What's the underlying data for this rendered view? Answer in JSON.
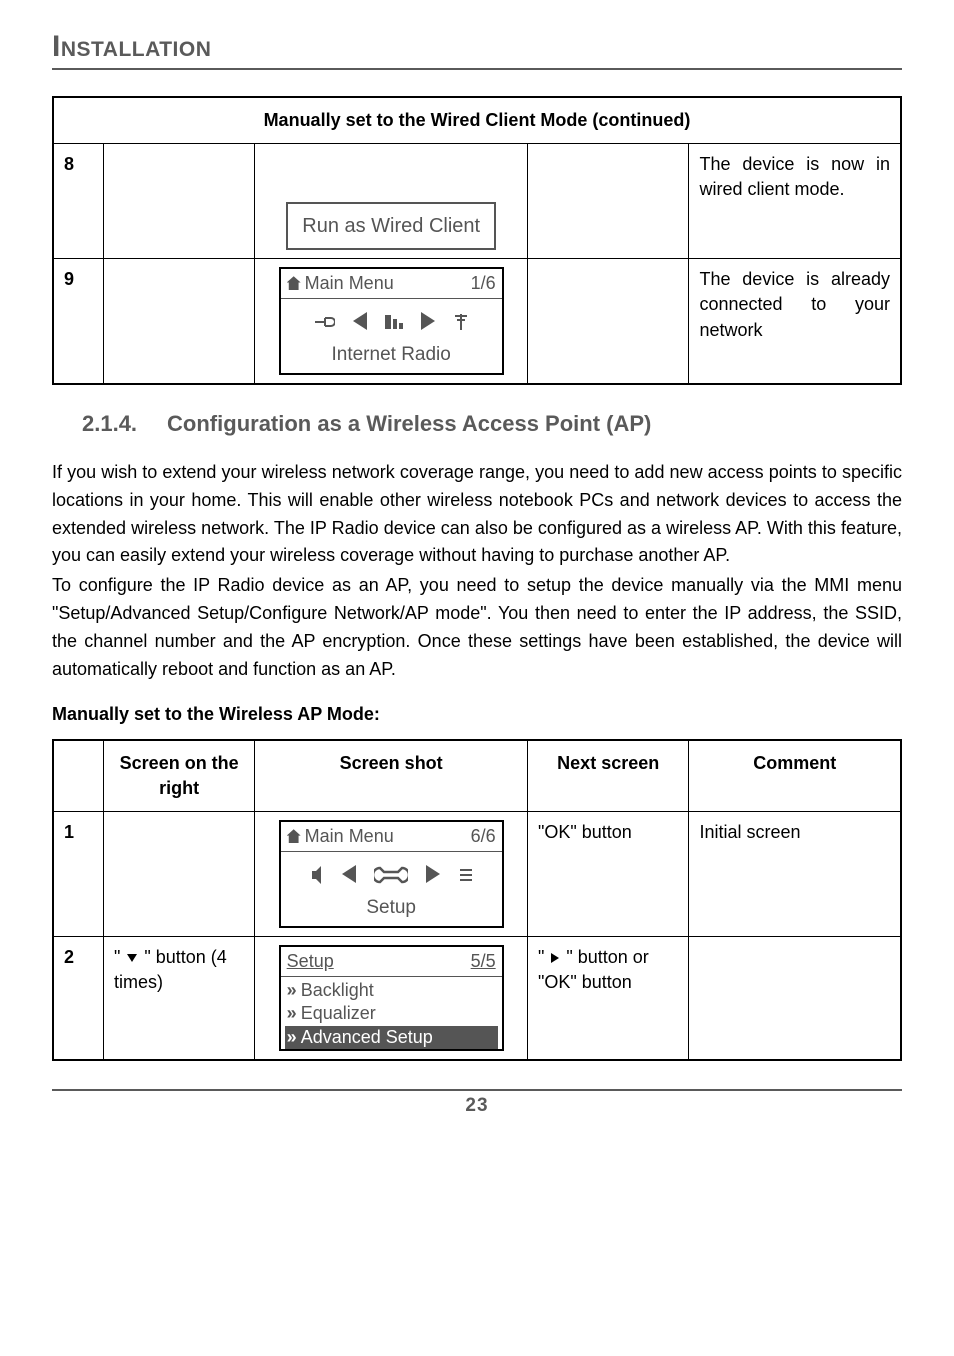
{
  "page_title": "Installation",
  "table1": {
    "header": "Manually set to the Wired Client Mode (continued)",
    "rows": [
      {
        "step": "8",
        "shot_caption": "Run as Wired Client",
        "comment": "The device is now in wired client mode."
      },
      {
        "step": "9",
        "menu_title": "Main Menu",
        "menu_page": "1/6",
        "shot_caption": "Internet Radio",
        "comment": "The device is already connected to your network"
      }
    ]
  },
  "section": {
    "number": "2.1.4.",
    "title": "Configuration as a Wireless Access Point (AP)"
  },
  "paragraphs": {
    "p1": "If you wish to extend your wireless network coverage range, you need to add new access points to specific locations in your home. This will enable other wireless notebook PCs and network devices to access the extended wireless network. The IP Radio device can also be configured as a wireless AP. With this feature, you can easily extend your wireless coverage without having to purchase another AP.",
    "p2": "To configure the IP Radio device as an AP, you need to setup the device manually via the MMI menu \"Setup/Advanced Setup/Configure Network/AP mode\". You then need to enter the IP address, the SSID, the channel number and the AP encryption. Once these settings have been established, the device will automatically reboot and function as an AP."
  },
  "subheading": "Manually set to the Wireless AP Mode:",
  "table2": {
    "headers": {
      "c1": "Screen on the right",
      "c2": "Screen shot",
      "c3": "Next screen",
      "c4": "Comment"
    },
    "rows": [
      {
        "step": "1",
        "right": "",
        "menu_title": "Main Menu",
        "menu_page": "6/6",
        "shot_caption": "Setup",
        "next": "\"OK\" button",
        "comment": "Initial screen"
      },
      {
        "step": "2",
        "right_prefix": "\" ",
        "right_suffix": " \" button (4 times)",
        "list_title": "Setup",
        "list_page": "5/5",
        "items": [
          "Backlight",
          "Equalizer",
          "Advanced Setup"
        ],
        "next_prefix": "\" ",
        "next_mid": " \" button or \"OK\" button",
        "comment": ""
      }
    ]
  },
  "page_number": "23"
}
